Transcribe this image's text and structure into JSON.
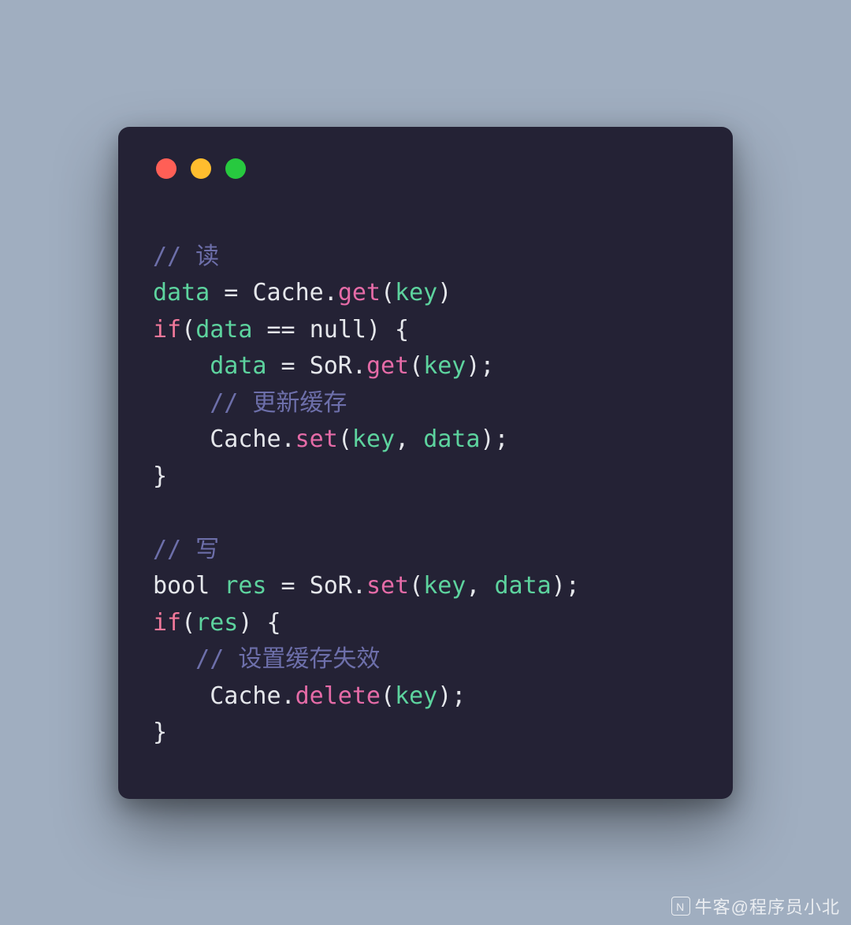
{
  "colors": {
    "page_bg": "#a0aec0",
    "window_bg": "#242235",
    "traffic_red": "#ff5f56",
    "traffic_yellow": "#ffbd2e",
    "traffic_green": "#27c93f",
    "comment": "#6d6faa",
    "identifier": "#5dd39e",
    "method": "#e56ba7",
    "keyword": "#f0789a",
    "default": "#e5e7eb"
  },
  "code": {
    "l1_comment": "// 读",
    "l2_a": "data",
    "l2_b": " = ",
    "l2_c": "Cache",
    "l2_d": ".",
    "l2_e": "get",
    "l2_f": "(",
    "l2_g": "key",
    "l2_h": ")",
    "l3_a": "if",
    "l3_b": "(",
    "l3_c": "data",
    "l3_d": " == ",
    "l3_e": "null",
    "l3_f": ") {",
    "l4_a": "    data",
    "l4_b": " = ",
    "l4_c": "SoR",
    "l4_d": ".",
    "l4_e": "get",
    "l4_f": "(",
    "l4_g": "key",
    "l4_h": ");",
    "l5_comment": "    // 更新缓存",
    "l6_a": "    Cache",
    "l6_b": ".",
    "l6_c": "set",
    "l6_d": "(",
    "l6_e": "key",
    "l6_f": ", ",
    "l6_g": "data",
    "l6_h": ");",
    "l7": "}",
    "l8": "",
    "l9_comment": "// 写",
    "l10_a": "bool",
    "l10_b": " ",
    "l10_c": "res",
    "l10_d": " = ",
    "l10_e": "SoR",
    "l10_f": ".",
    "l10_g": "set",
    "l10_h": "(",
    "l10_i": "key",
    "l10_j": ", ",
    "l10_k": "data",
    "l10_l": ");",
    "l11_a": "if",
    "l11_b": "(",
    "l11_c": "res",
    "l11_d": ") {",
    "l12_comment": "   // 设置缓存失效",
    "l13_a": "    Cache",
    "l13_b": ".",
    "l13_c": "delete",
    "l13_d": "(",
    "l13_e": "key",
    "l13_f": ");",
    "l14": "}"
  },
  "watermark": {
    "text": "牛客@程序员小北"
  }
}
